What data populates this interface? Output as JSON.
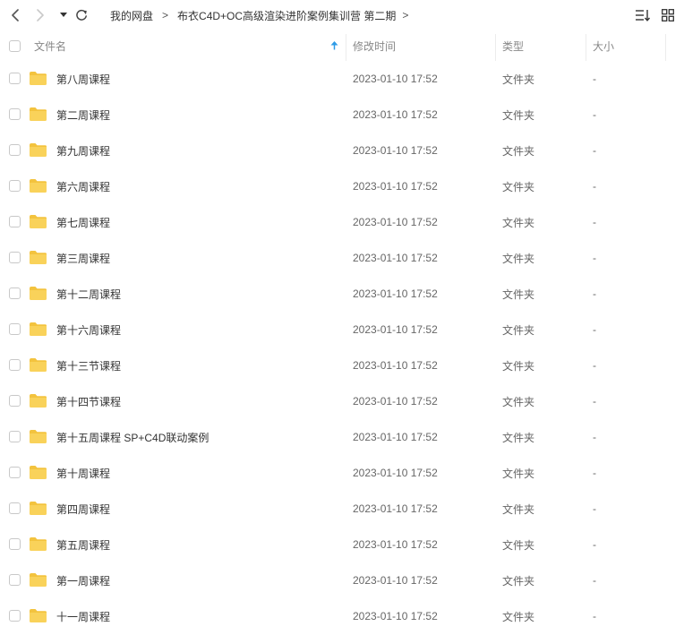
{
  "breadcrumb": {
    "items": [
      "我的网盘",
      "布衣C4D+OC高级渲染进阶案例集训营 第二期"
    ],
    "separator": ">"
  },
  "header": {
    "name": "文件名",
    "modified": "修改时间",
    "type": "类型",
    "size": "大小"
  },
  "sort": {
    "column": "name",
    "direction": "ascending"
  },
  "colors": {
    "folder": "#F9D25A",
    "folder_tab": "#F3C33E",
    "sort_arrow": "#2E9BE6"
  },
  "files": [
    {
      "name": "第八周课程",
      "modified": "2023-01-10 17:52",
      "type": "文件夹",
      "size": "-"
    },
    {
      "name": "第二周课程",
      "modified": "2023-01-10 17:52",
      "type": "文件夹",
      "size": "-"
    },
    {
      "name": "第九周课程",
      "modified": "2023-01-10 17:52",
      "type": "文件夹",
      "size": "-"
    },
    {
      "name": "第六周课程",
      "modified": "2023-01-10 17:52",
      "type": "文件夹",
      "size": "-"
    },
    {
      "name": "第七周课程",
      "modified": "2023-01-10 17:52",
      "type": "文件夹",
      "size": "-"
    },
    {
      "name": "第三周课程",
      "modified": "2023-01-10 17:52",
      "type": "文件夹",
      "size": "-"
    },
    {
      "name": "第十二周课程",
      "modified": "2023-01-10 17:52",
      "type": "文件夹",
      "size": "-"
    },
    {
      "name": "第十六周课程",
      "modified": "2023-01-10 17:52",
      "type": "文件夹",
      "size": "-"
    },
    {
      "name": "第十三节课程",
      "modified": "2023-01-10 17:52",
      "type": "文件夹",
      "size": "-"
    },
    {
      "name": "第十四节课程",
      "modified": "2023-01-10 17:52",
      "type": "文件夹",
      "size": "-"
    },
    {
      "name": "第十五周课程 SP+C4D联动案例",
      "modified": "2023-01-10 17:52",
      "type": "文件夹",
      "size": "-"
    },
    {
      "name": "第十周课程",
      "modified": "2023-01-10 17:52",
      "type": "文件夹",
      "size": "-"
    },
    {
      "name": "第四周课程",
      "modified": "2023-01-10 17:52",
      "type": "文件夹",
      "size": "-"
    },
    {
      "name": "第五周课程",
      "modified": "2023-01-10 17:52",
      "type": "文件夹",
      "size": "-"
    },
    {
      "name": "第一周课程",
      "modified": "2023-01-10 17:52",
      "type": "文件夹",
      "size": "-"
    },
    {
      "name": "十一周课程",
      "modified": "2023-01-10 17:52",
      "type": "文件夹",
      "size": "-"
    }
  ]
}
